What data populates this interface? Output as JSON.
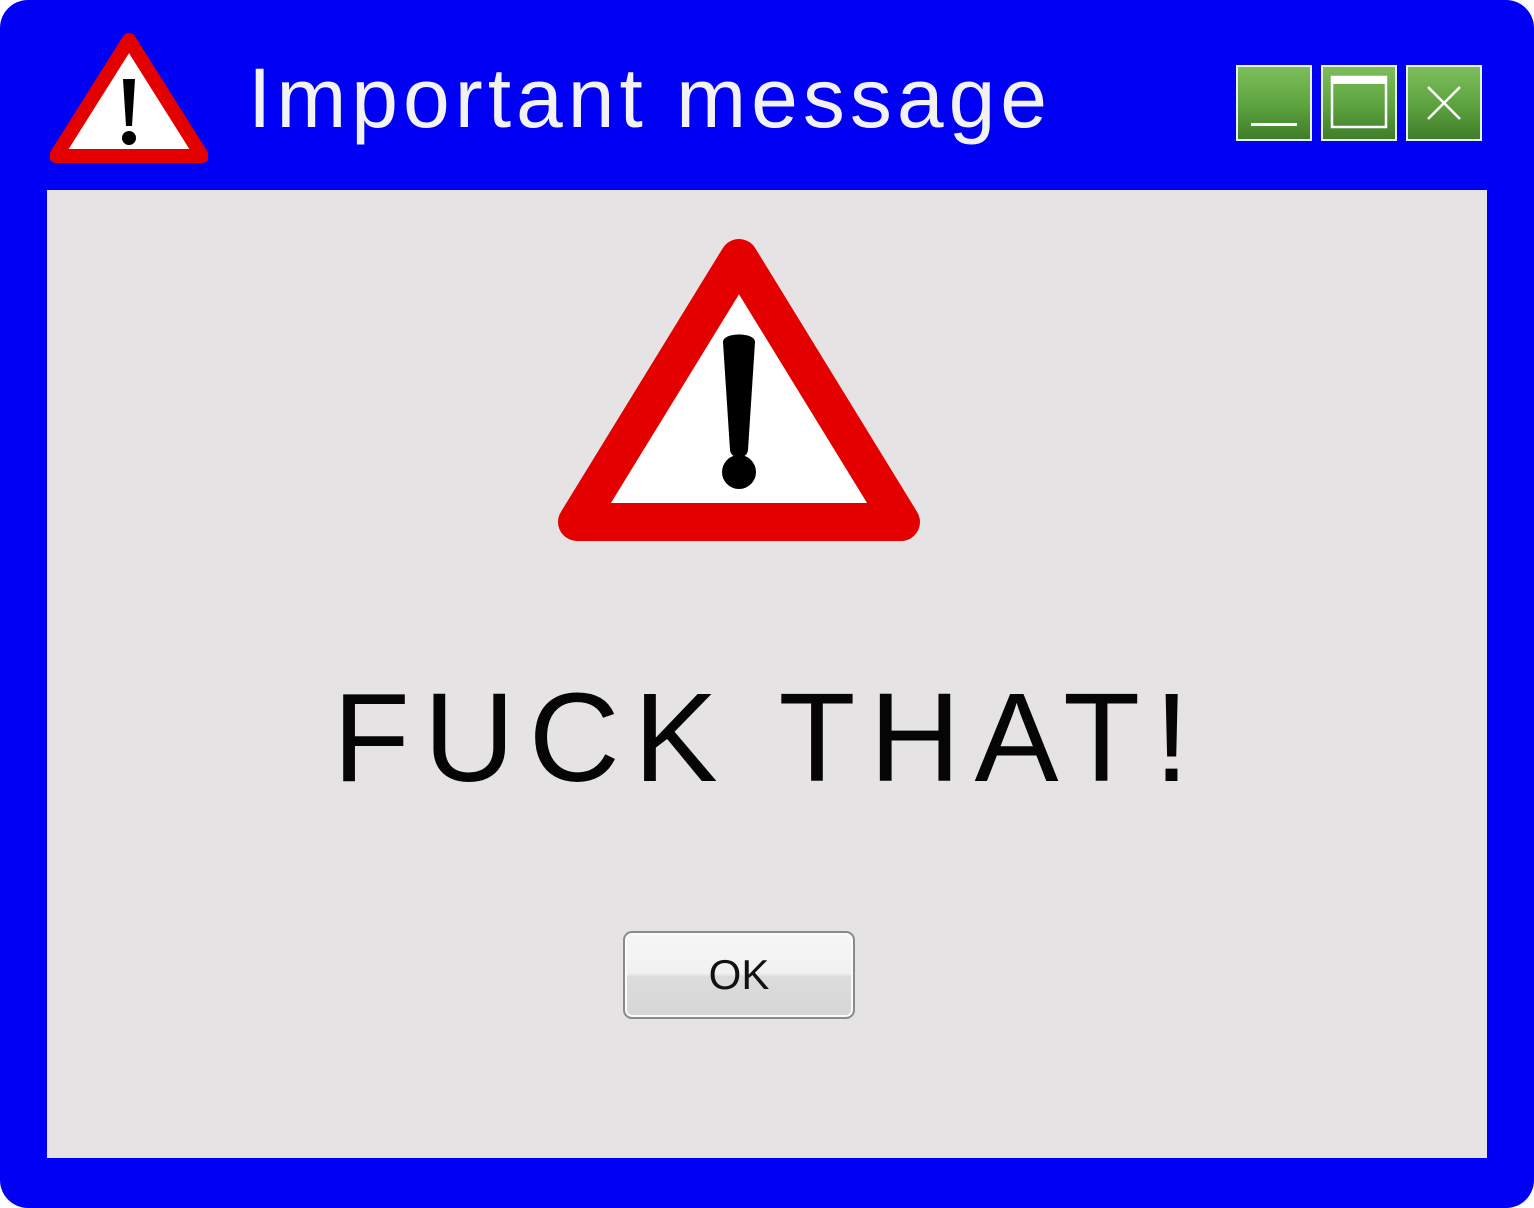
{
  "window": {
    "title": "Important message",
    "frame_color": "#0000f5",
    "content_background": "#e5e3e4",
    "controls": {
      "minimize_icon": "minimize-icon",
      "maximize_icon": "maximize-icon",
      "close_icon": "close-icon",
      "control_color": "#5fa540"
    }
  },
  "dialog": {
    "icon": "warning-triangle-icon",
    "icon_colors": {
      "border": "#e50000",
      "fill": "#ffffff",
      "mark": "#000000"
    },
    "message": "FUCK THAT!",
    "ok_label": "OK"
  }
}
